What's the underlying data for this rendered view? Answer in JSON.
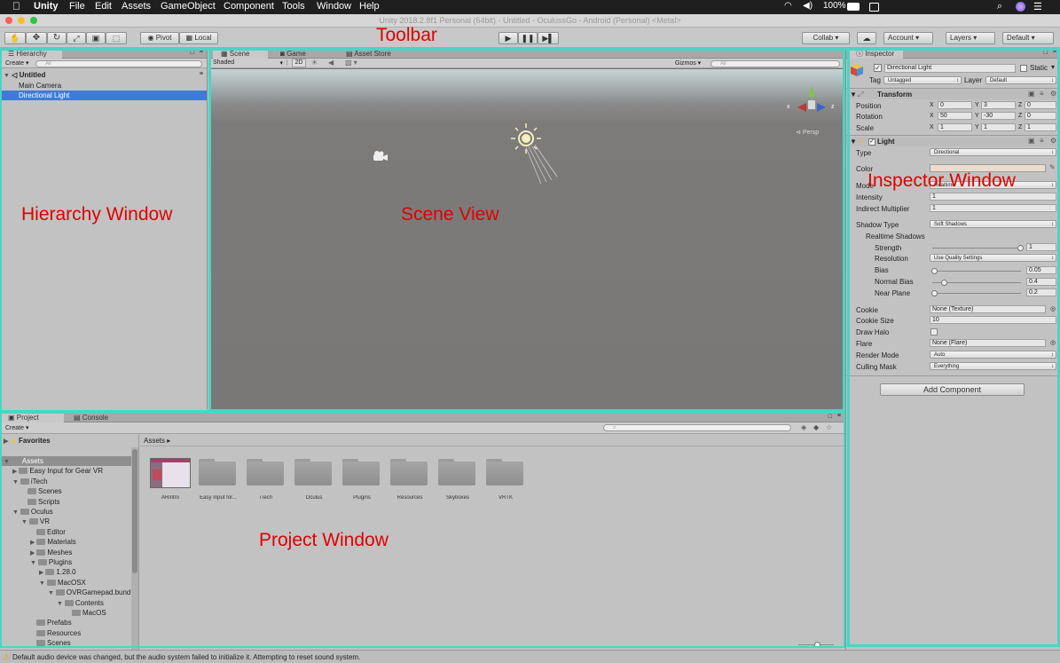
{
  "menubar": {
    "app": "Unity",
    "items": [
      "File",
      "Edit",
      "Assets",
      "GameObject",
      "Component",
      "Tools",
      "Window",
      "Help"
    ],
    "battery": "100%"
  },
  "window_title": "Unity 2018.2.8f1 Personal (64bit) - Untitled - OculussGo - Android (Personal) <Metal>",
  "toolbar": {
    "pivot": "Pivot",
    "local": "Local",
    "collab": "Collab ▾",
    "account": "Account",
    "layers": "Layers",
    "layout": "Default"
  },
  "annotations": {
    "toolbar": "Toolbar",
    "hierarchy": "Hierarchy Window",
    "scene": "Scene View",
    "inspector": "Inspector Window",
    "project": "Project Window"
  },
  "hierarchy": {
    "tab": "Hierarchy",
    "create": "Create",
    "search_placeholder": "All",
    "scene_name": "Untitled",
    "items": [
      "Main Camera",
      "Directional Light"
    ]
  },
  "scene": {
    "tabs": [
      "Scene",
      "Game",
      "Asset Store"
    ],
    "shading": "Shaded",
    "mode_2d": "2D",
    "gizmos": "Gizmos",
    "search_placeholder": "All",
    "persp": "Persp",
    "axis_x": "x",
    "axis_z": "z"
  },
  "inspector": {
    "tab": "Inspector",
    "object_name": "Directional Light",
    "static_label": "Static",
    "tag_label": "Tag",
    "tag_value": "Untagged",
    "layer_label": "Layer",
    "layer_value": "Default",
    "transform": {
      "title": "Transform",
      "rows": [
        {
          "label": "Position",
          "x": "0",
          "y": "3",
          "z": "0"
        },
        {
          "label": "Rotation",
          "x": "50",
          "y": "-30",
          "z": "0"
        },
        {
          "label": "Scale",
          "x": "1",
          "y": "1",
          "z": "1"
        }
      ]
    },
    "light": {
      "title": "Light",
      "type_label": "Type",
      "type_value": "Directional",
      "color_label": "Color",
      "mode_label": "Mode",
      "mode_value": "Realtime",
      "intensity_label": "Intensity",
      "intensity_value": "1",
      "indirect_label": "Indirect Multiplier",
      "indirect_value": "1",
      "shadow_type_label": "Shadow Type",
      "shadow_type_value": "Soft Shadows",
      "realtime_shadows": "Realtime Shadows",
      "strength_label": "Strength",
      "strength_value": "1",
      "resolution_label": "Resolution",
      "resolution_value": "Use Quality Settings",
      "bias_label": "Bias",
      "bias_value": "0.05",
      "normal_bias_label": "Normal Bias",
      "normal_bias_value": "0.4",
      "near_plane_label": "Near Plane",
      "near_plane_value": "0.2",
      "cookie_label": "Cookie",
      "cookie_value": "None (Texture)",
      "cookie_size_label": "Cookie Size",
      "cookie_size_value": "10",
      "draw_halo_label": "Draw Halo",
      "flare_label": "Flare",
      "flare_value": "None (Flare)",
      "render_mode_label": "Render Mode",
      "render_mode_value": "Auto",
      "culling_mask_label": "Culling Mask",
      "culling_mask_value": "Everything"
    },
    "add_component": "Add Component"
  },
  "project": {
    "tabs": [
      "Project",
      "Console"
    ],
    "create": "Create",
    "favorites": "Favorites",
    "breadcrumb": "Assets ▸",
    "tree": [
      {
        "label": "Assets",
        "depth": 0
      },
      {
        "label": "Easy Input for Gear VR",
        "depth": 1
      },
      {
        "label": "iTech",
        "depth": 1
      },
      {
        "label": "Scenes",
        "depth": 2
      },
      {
        "label": "Scripts",
        "depth": 2
      },
      {
        "label": "Oculus",
        "depth": 1
      },
      {
        "label": "VR",
        "depth": 2
      },
      {
        "label": "Editor",
        "depth": 3
      },
      {
        "label": "Materials",
        "depth": 3
      },
      {
        "label": "Meshes",
        "depth": 3
      },
      {
        "label": "Plugins",
        "depth": 3
      },
      {
        "label": "1.28.0",
        "depth": 4
      },
      {
        "label": "MacOSX",
        "depth": 4
      },
      {
        "label": "OVRGamepad.bund",
        "depth": 5
      },
      {
        "label": "Contents",
        "depth": 6
      },
      {
        "label": "MacOS",
        "depth": 7
      },
      {
        "label": "Prefabs",
        "depth": 3
      },
      {
        "label": "Resources",
        "depth": 3
      },
      {
        "label": "Scenes",
        "depth": 3
      }
    ],
    "assets": [
      "ARintro",
      "Easy Input for...",
      "iTech",
      "Oculus",
      "Plugins",
      "Resources",
      "Skyboxes",
      "VRTK"
    ]
  },
  "status_message": "Default audio device was changed, but the audio system failed to initialize it. Attempting to reset sound system.",
  "colors": {
    "highlight": "#46d6c4",
    "annotation": "#e00000",
    "selection": "#3e7bd6"
  }
}
